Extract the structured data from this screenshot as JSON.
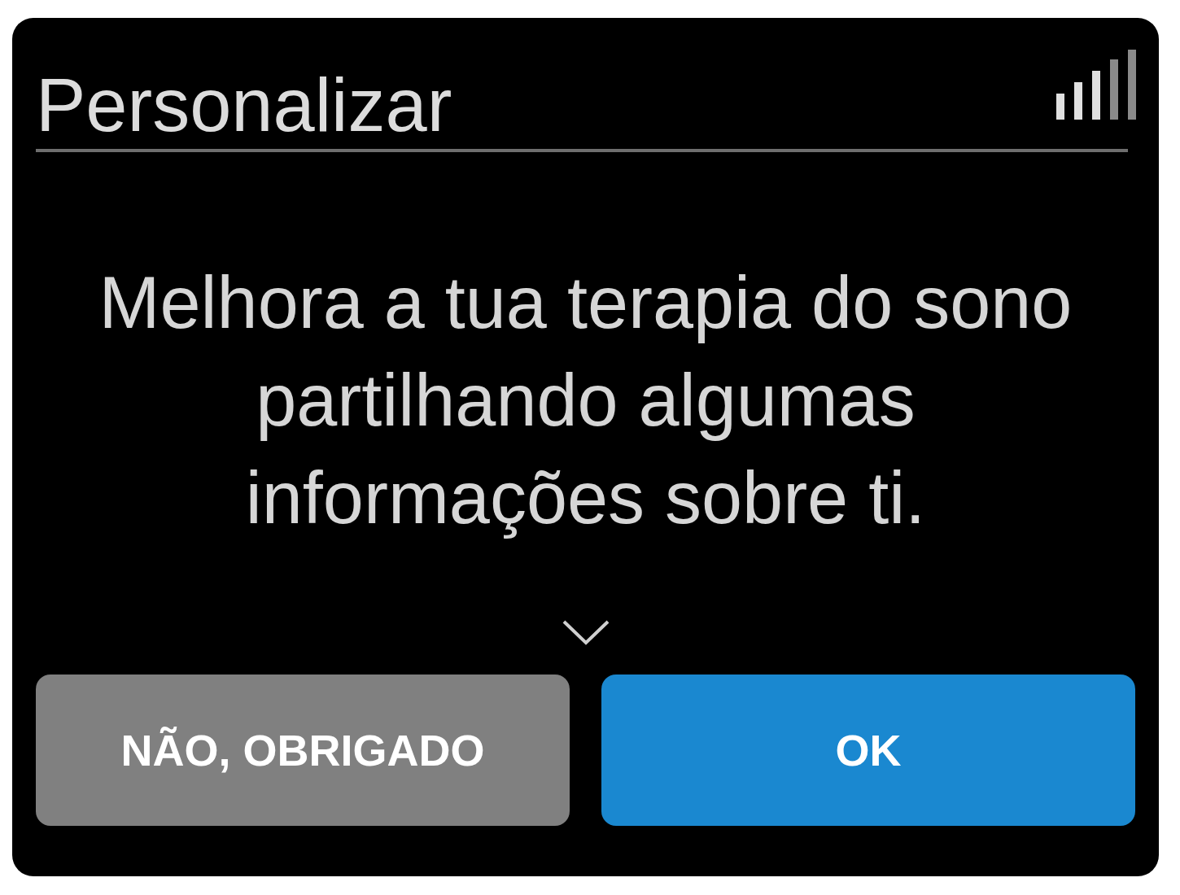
{
  "header": {
    "title": "Personalizar"
  },
  "message": "Melhora a tua terapia do sono partilhando algumas informações sobre ti.",
  "buttons": [
    {
      "label": "NÃO, OBRIGADO",
      "kind": "secondary"
    },
    {
      "label": "OK",
      "kind": "primary"
    }
  ]
}
